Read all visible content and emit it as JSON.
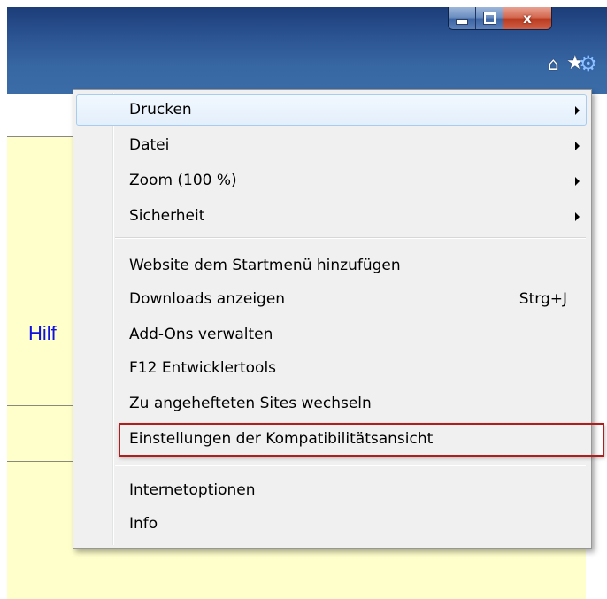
{
  "window": {
    "caption_buttons": {
      "minimize": "—",
      "maximize": "□",
      "close": "x"
    },
    "toolbar_icons": [
      "home-icon",
      "star-icon",
      "gear-icon"
    ]
  },
  "page": {
    "link_text": "Hilf"
  },
  "menu": {
    "items": [
      {
        "label": "Drucken",
        "submenu": true,
        "highlighted": true
      },
      {
        "label": "Datei",
        "submenu": true
      },
      {
        "label": "Zoom (100 %)",
        "submenu": true
      },
      {
        "label": "Sicherheit",
        "submenu": true
      },
      {
        "label": "Website dem Startmenü hinzufügen"
      },
      {
        "label": "Downloads anzeigen",
        "shortcut": "Strg+J"
      },
      {
        "label": "Add-Ons verwalten"
      },
      {
        "label": "F12 Entwicklertools"
      },
      {
        "label": "Zu angehefteten Sites wechseln"
      },
      {
        "label": "Einstellungen der Kompatibilitätsansicht",
        "annotated": true
      },
      {
        "label": "Internetoptionen"
      },
      {
        "label": "Info"
      }
    ]
  },
  "colors": {
    "annotation_box": "#b11c1c",
    "page_background": "#ffffcc",
    "link": "#1010e0"
  }
}
